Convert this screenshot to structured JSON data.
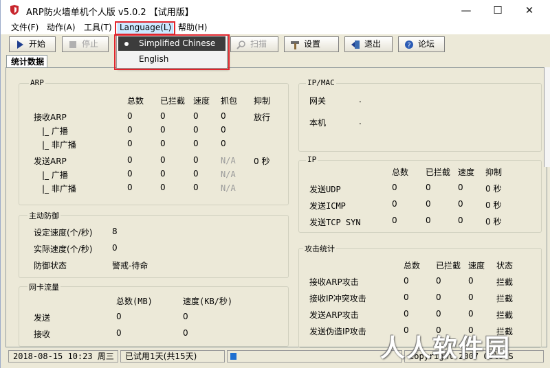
{
  "window": {
    "title": "ARP防火墙单机个人版 v5.0.2 【试用版】"
  },
  "menu": [
    "文件(F)",
    "动作(A)",
    "工具(T)",
    "Language(L)",
    "帮助(H)"
  ],
  "toolbar": {
    "start": "开始",
    "stop": "停止",
    "scan": "扫描",
    "settings": "设置",
    "exit": "退出",
    "forum": "论坛"
  },
  "language_menu": {
    "items": [
      "Simplified Chinese",
      "English"
    ],
    "selected": "Simplified Chinese"
  },
  "tab": "统计数据",
  "arp": {
    "title": "ARP",
    "headers": [
      "总数",
      "已拦截",
      "速度",
      "抓包",
      "抑制"
    ],
    "rows": [
      {
        "label": "接收ARP",
        "v": [
          "0",
          "0",
          "0",
          "0"
        ],
        "s": "放行"
      },
      {
        "label": "|_ 广播",
        "v": [
          "0",
          "0",
          "0",
          "0"
        ],
        "s": ""
      },
      {
        "label": "|_ 非广播",
        "v": [
          "0",
          "0",
          "0",
          "0"
        ],
        "s": ""
      },
      {
        "label": "发送ARP",
        "v": [
          "0",
          "0",
          "0",
          "N/A"
        ],
        "s": "0 秒"
      },
      {
        "label": "|_ 广播",
        "v": [
          "0",
          "0",
          "0",
          "N/A"
        ],
        "s": ""
      },
      {
        "label": "|_ 非广播",
        "v": [
          "0",
          "0",
          "0",
          "N/A"
        ],
        "s": ""
      }
    ]
  },
  "defense": {
    "title": "主动防御",
    "rows": [
      {
        "label": "设定速度(个/秒)",
        "value": "8"
      },
      {
        "label": "实际速度(个/秒)",
        "value": "0"
      },
      {
        "label": "防御状态",
        "value": "警戒-待命"
      }
    ]
  },
  "nic": {
    "title": "网卡流量",
    "headers": [
      "总数(MB)",
      "速度(KB/秒)"
    ],
    "rows": [
      {
        "label": "发送",
        "v": [
          "0",
          "0"
        ]
      },
      {
        "label": "接收",
        "v": [
          "0",
          "0"
        ]
      }
    ]
  },
  "ipmac": {
    "title": "IP/MAC",
    "rows": [
      {
        "label": "网关",
        "value": "."
      },
      {
        "label": "本机",
        "value": "."
      }
    ]
  },
  "ip": {
    "title": "IP",
    "headers": [
      "总数",
      "已拦截",
      "速度",
      "抑制"
    ],
    "rows": [
      {
        "label": "发送UDP",
        "v": [
          "0",
          "0",
          "0",
          "0 秒"
        ]
      },
      {
        "label": "发送ICMP",
        "v": [
          "0",
          "0",
          "0",
          "0 秒"
        ]
      },
      {
        "label": "发送TCP SYN",
        "v": [
          "0",
          "0",
          "0",
          "0 秒"
        ]
      }
    ]
  },
  "attack": {
    "title": "攻击统计",
    "headers": [
      "总数",
      "已拦截",
      "速度",
      "状态"
    ],
    "rows": [
      {
        "label": "接收ARP攻击",
        "v": [
          "0",
          "0",
          "0",
          "拦截"
        ]
      },
      {
        "label": "接收IP冲突攻击",
        "v": [
          "0",
          "0",
          "0",
          "拦截"
        ]
      },
      {
        "label": "发送ARP攻击",
        "v": [
          "0",
          "0",
          "0",
          "拦截"
        ]
      },
      {
        "label": "发送伪造IP攻击",
        "v": [
          "0",
          "0",
          "0",
          "拦截"
        ]
      }
    ]
  },
  "status": {
    "datetime": "2018-08-15 10:23 周三",
    "trial": "已试用1天(共15天)",
    "copyright": "Copyright 2007 ColorS"
  },
  "watermark": "人人软件园"
}
